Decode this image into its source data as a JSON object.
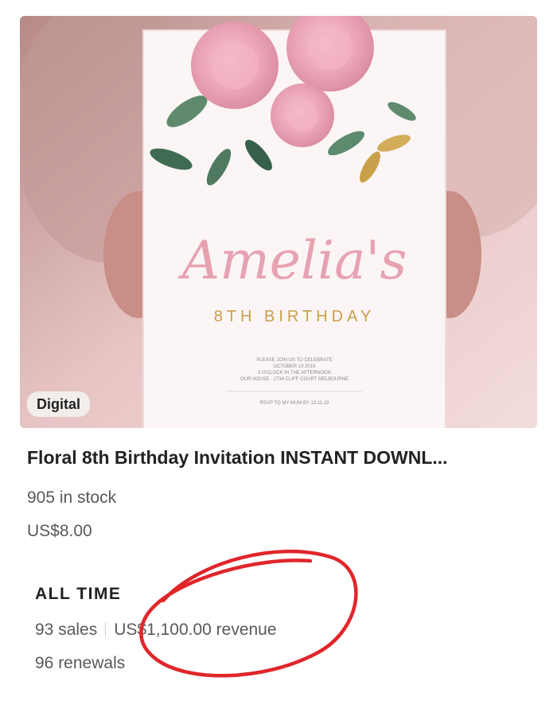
{
  "listing": {
    "image_alt": "Floral birthday invitation card held in hands",
    "badge": "Digital",
    "title": "Floral 8th Birthday Invitation INSTANT DOWNL...",
    "stock": "905 in stock",
    "price": "US$8.00"
  },
  "invitation_image_text": {
    "name": "Amelia's",
    "occasion": "8TH BIRTHDAY",
    "details_line1": "PLEASE JOIN US TO CELEBRATE",
    "details_line2": "OCTOBER 13 2019",
    "details_line3": "3 O'CLOCK IN THE AFTERNOON",
    "details_line4": "OUR HOUSE · 2734 CLIFF COURT MELBOURNE",
    "rsvp": "RSVP TO MY MUM BY 13.11.19"
  },
  "stats": {
    "section_label": "ALL TIME",
    "sales": "93 sales",
    "revenue": "US$1,100.00 revenue",
    "renewals": "96 renewals"
  },
  "colors": {
    "annotation_circle": "#e0262b",
    "accent_gold": "#c9a04a",
    "accent_pink": "#e7a2b0"
  }
}
